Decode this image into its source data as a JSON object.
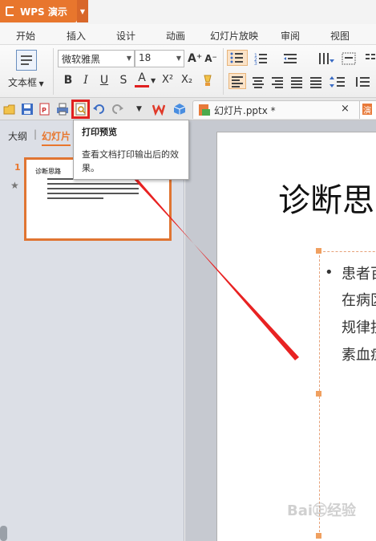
{
  "app": {
    "name": "WPS 演示"
  },
  "tabs": [
    "开始",
    "插入",
    "设计",
    "动画",
    "幻灯片放映",
    "审阅",
    "视图"
  ],
  "ribbon": {
    "textbox_label": "文本框",
    "font_name": "微软雅黑",
    "font_size": "18",
    "bold": "B",
    "italic": "I",
    "underline": "U",
    "strike": "S",
    "font_color": "A",
    "superscript": "X²",
    "subscript": "X₂",
    "grow": "A⁺",
    "shrink": "A⁻"
  },
  "document_tab": {
    "title": "幻灯片.pptx *",
    "close": "×",
    "second_tab": "演"
  },
  "left_pane": {
    "tab_outline": "大纲",
    "tab_slides": "幻灯片",
    "slide_number": "1",
    "thumbnail_title": "诊断思路"
  },
  "tooltip": {
    "title": "打印预览",
    "description": "查看文档打印输出后的效果。"
  },
  "slide": {
    "title": "诊断思",
    "bullet": "•",
    "lines": [
      "患者百",
      "在病区",
      "规律抗",
      "素血症"
    ]
  },
  "watermark": "Bai㊣经验",
  "colors": {
    "accent": "#e8762d",
    "highlight_box": "#e02020",
    "arrow": "#e82222",
    "tab_active": "#e8762d"
  }
}
